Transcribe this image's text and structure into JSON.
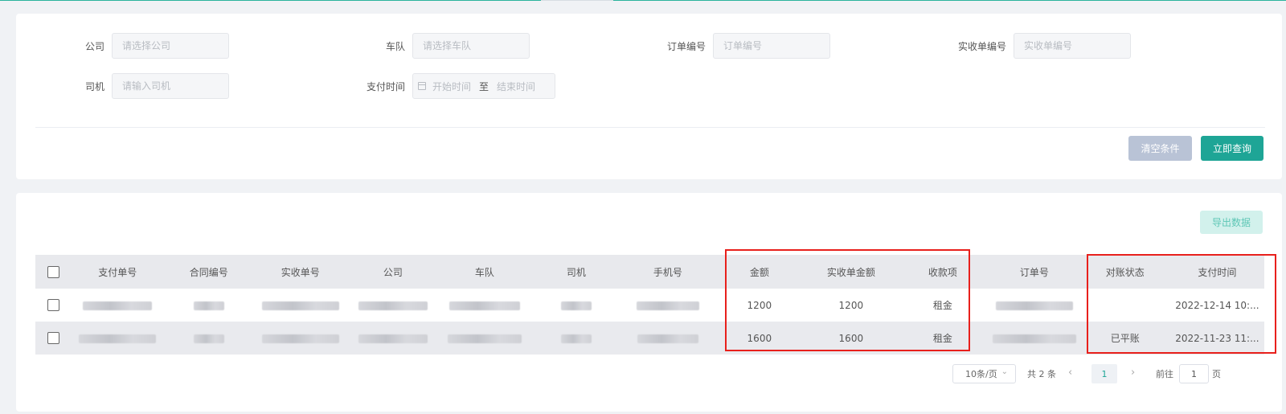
{
  "filters": {
    "company": {
      "label": "公司",
      "placeholder": "请选择公司"
    },
    "fleet": {
      "label": "车队",
      "placeholder": "请选择车队"
    },
    "order_no": {
      "label": "订单编号",
      "placeholder": "订单编号"
    },
    "receipt_no": {
      "label": "实收单编号",
      "placeholder": "实收单编号"
    },
    "driver": {
      "label": "司机",
      "placeholder": "请输入司机"
    },
    "pay_time": {
      "label": "支付时间",
      "start_placeholder": "开始时间",
      "separator": "至",
      "end_placeholder": "结束时间"
    }
  },
  "actions": {
    "clear_label": "清空条件",
    "query_label": "立即查询",
    "export_label": "导出数据"
  },
  "table": {
    "columns": [
      "支付单号",
      "合同编号",
      "实收单号",
      "公司",
      "车队",
      "司机",
      "手机号",
      "金额",
      "实收单金额",
      "收款项",
      "订单号",
      "对账状态",
      "支付时间"
    ],
    "rows": [
      {
        "amount": "1200",
        "receipt_amount": "1200",
        "item": "租金",
        "status": "",
        "pay_time": "2022-12-14 10:..."
      },
      {
        "amount": "1600",
        "receipt_amount": "1600",
        "item": "租金",
        "status": "已平账",
        "pay_time": "2022-11-23 11:..."
      }
    ]
  },
  "pagination": {
    "page_size": "10条/页",
    "total": "共 2 条",
    "current_page": "1",
    "goto_label": "前往",
    "goto_value": "1",
    "page_suffix": "页"
  },
  "colors": {
    "accent": "#1ea596",
    "highlight": "#e8201c"
  }
}
